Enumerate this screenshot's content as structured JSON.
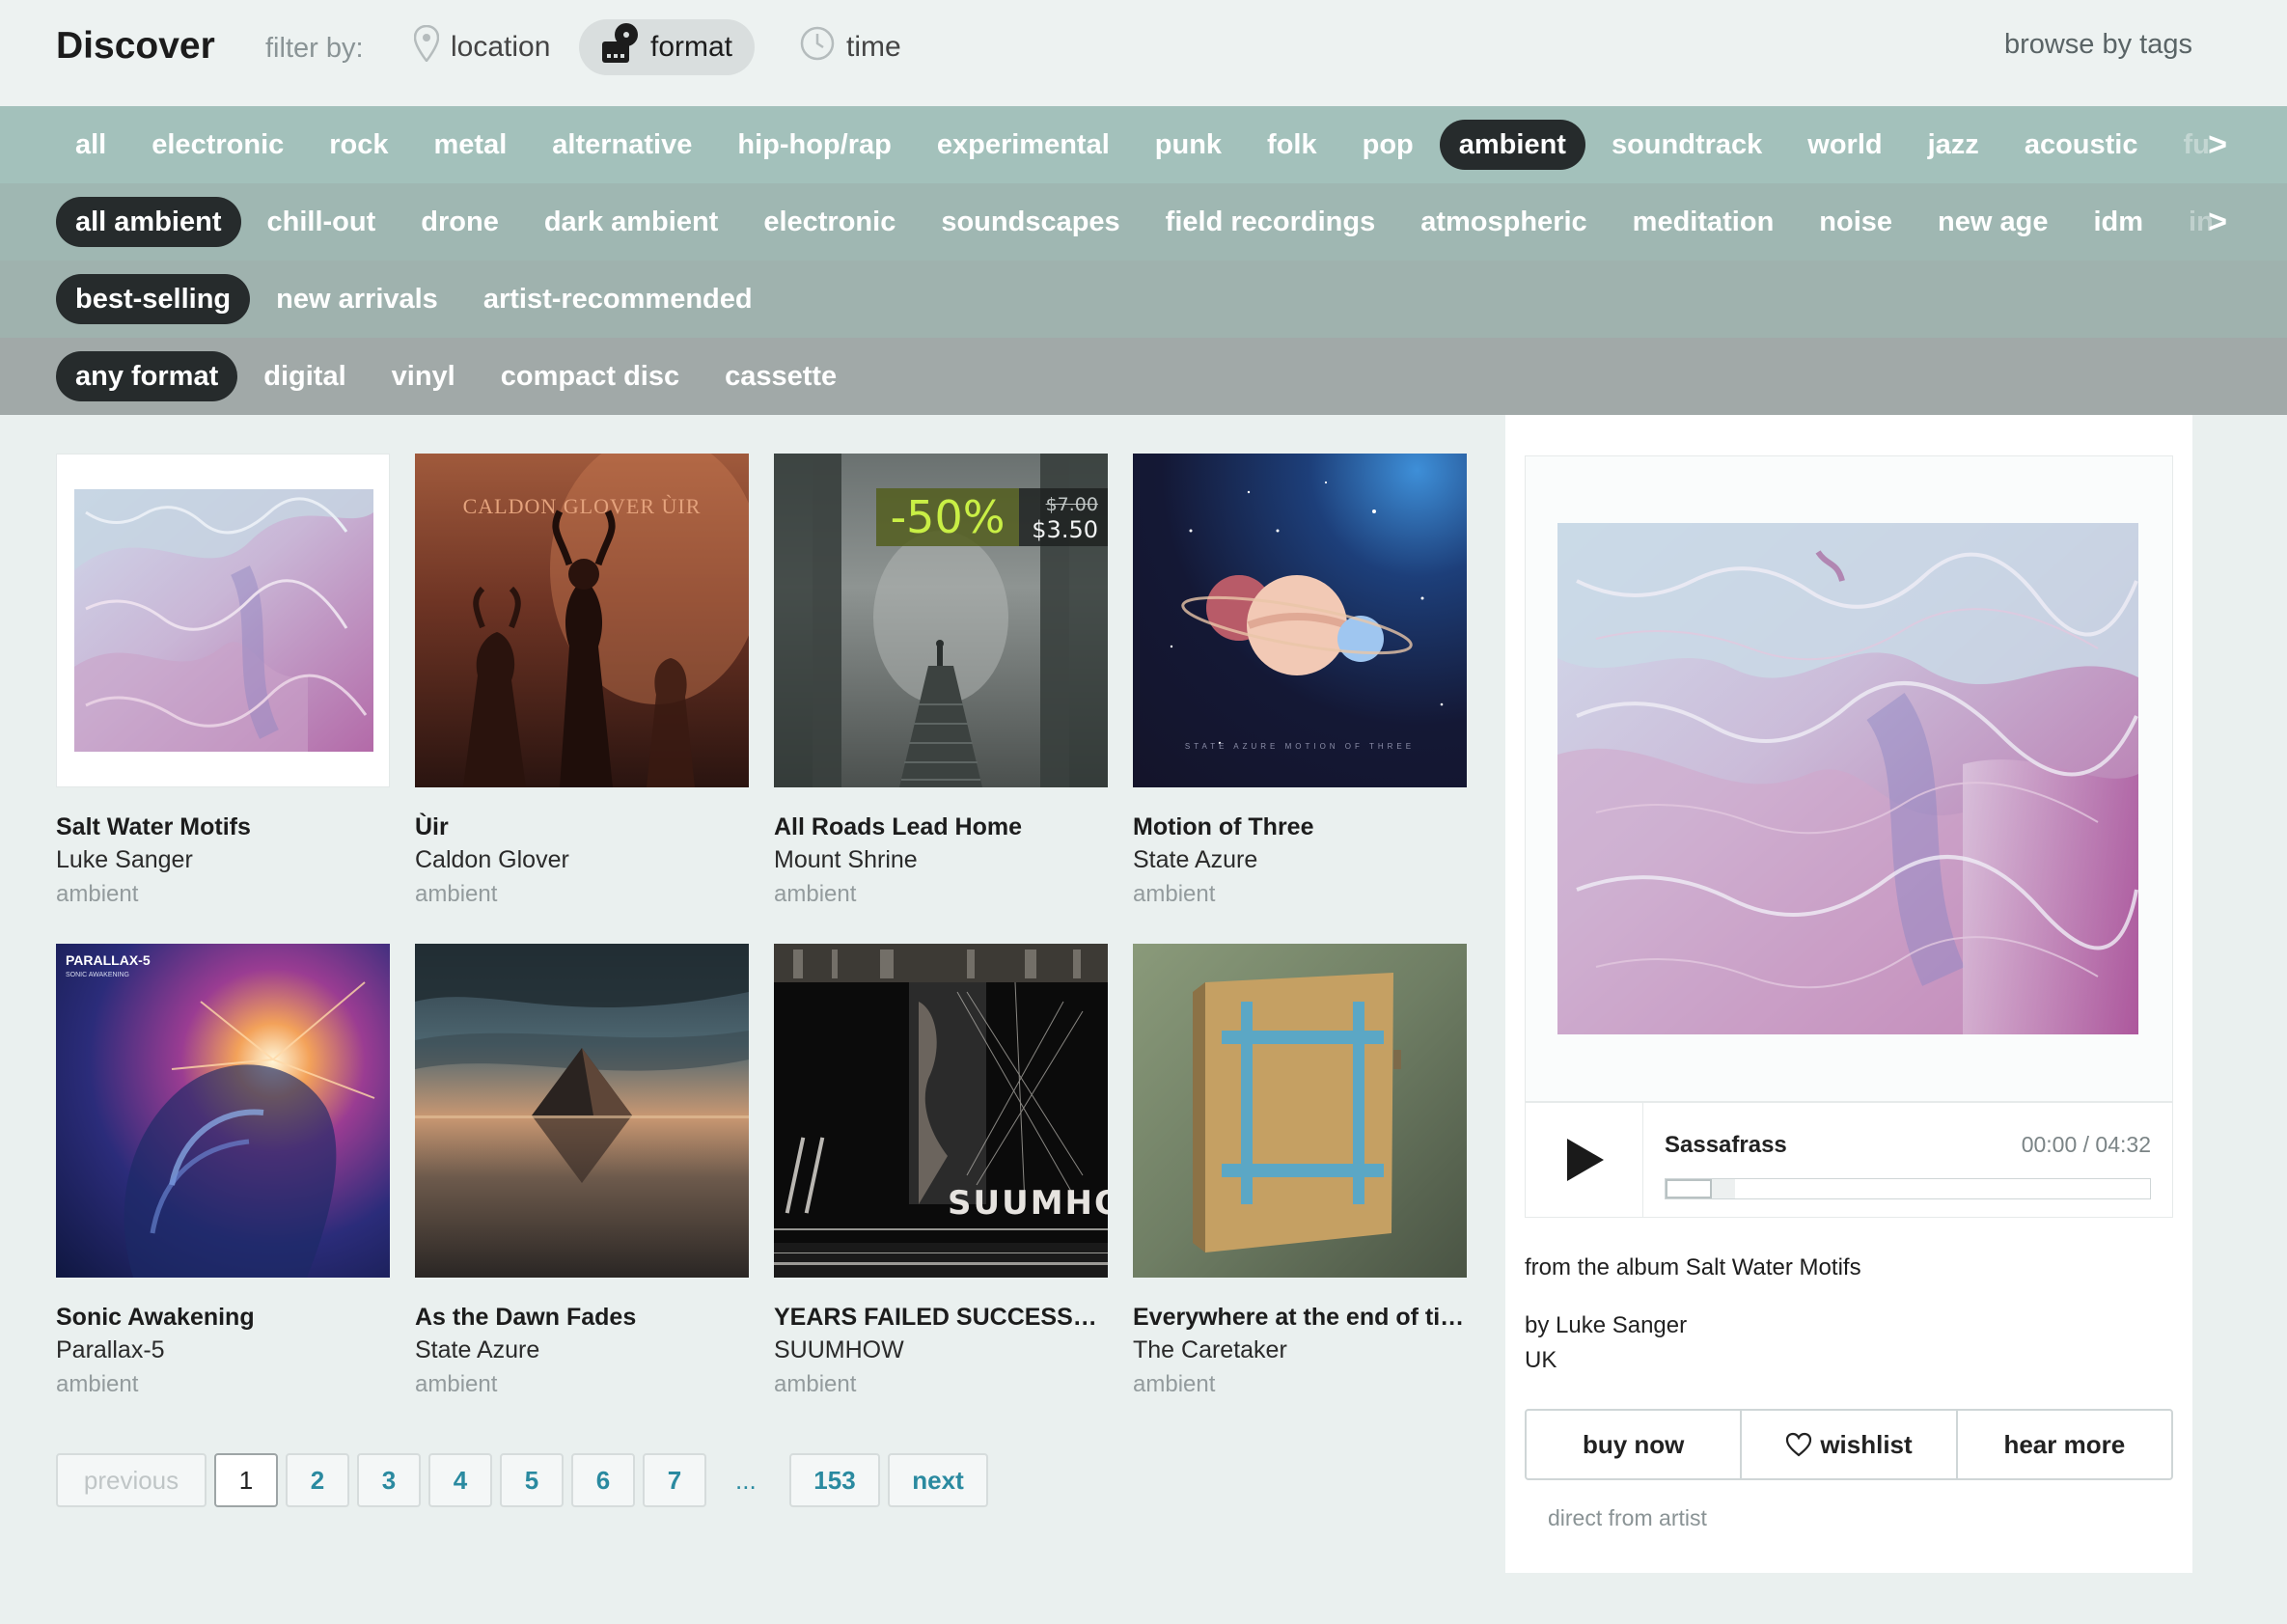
{
  "header": {
    "title": "Discover",
    "filter_label": "filter by:",
    "filters": [
      {
        "label": "location",
        "icon": "map-pin-icon"
      },
      {
        "label": "format",
        "icon": "vinyl-player-icon",
        "active": true
      },
      {
        "label": "time",
        "icon": "clock-icon"
      }
    ],
    "browse_tags": "browse by tags"
  },
  "genres": [
    "all",
    "electronic",
    "rock",
    "metal",
    "alternative",
    "hip-hop/rap",
    "experimental",
    "punk",
    "folk",
    "pop",
    "ambient",
    "soundtrack",
    "world",
    "jazz",
    "acoustic",
    "fu"
  ],
  "genre_active": "ambient",
  "subgenres": [
    "all ambient",
    "chill-out",
    "drone",
    "dark ambient",
    "electronic",
    "soundscapes",
    "field recordings",
    "atmospheric",
    "meditation",
    "noise",
    "new age",
    "idm",
    "in"
  ],
  "subgenre_active": "all ambient",
  "sorts": [
    "best-selling",
    "new arrivals",
    "artist-recommended"
  ],
  "sort_active": "best-selling",
  "formats": [
    "any format",
    "digital",
    "vinyl",
    "compact disc",
    "cassette"
  ],
  "format_active": "any format",
  "row_arrow": ">",
  "albums": [
    {
      "title": "Salt Water Motifs",
      "artist": "Luke Sanger",
      "genre": "ambient"
    },
    {
      "title": "Ùir",
      "artist": "Caldon Glover",
      "genre": "ambient",
      "cover_text": "CALDON GLOVER ÙIR"
    },
    {
      "title": "All Roads Lead Home",
      "artist": "Mount Shrine",
      "genre": "ambient",
      "discount": "-50%",
      "old_price": "$7.00",
      "new_price": "$3.50"
    },
    {
      "title": "Motion of Three",
      "artist": "State Azure",
      "genre": "ambient",
      "cover_text": "STATE AZURE     MOTION OF THREE"
    },
    {
      "title": "Sonic Awakening",
      "artist": "Parallax-5",
      "genre": "ambient",
      "cover_text": "PARALLAX-5",
      "cover_sub": "SONIC AWAKENING"
    },
    {
      "title": "As the Dawn Fades",
      "artist": "State Azure",
      "genre": "ambient"
    },
    {
      "title": "YEARS FAILED SUCCESSF…",
      "artist": "SUUMHOW",
      "genre": "ambient",
      "cover_text": "SUUMHOW"
    },
    {
      "title": "Everywhere at the end of time",
      "artist": "The Caretaker",
      "genre": "ambient"
    }
  ],
  "pagination": {
    "previous": "previous",
    "pages": [
      "1",
      "2",
      "3",
      "4",
      "5",
      "6",
      "7"
    ],
    "ellipsis": "...",
    "last": "153",
    "next": "next",
    "current": "1"
  },
  "player": {
    "track": "Sassafrass",
    "time": "00:00 / 04:32",
    "progress": 0.0,
    "from_prefix": "from the album",
    "album": "Salt Water Motifs",
    "by_line": "by Luke Sanger",
    "location": "UK",
    "buy_label": "buy now",
    "wishlist_label": "wishlist",
    "hear_more_label": "hear more",
    "direct": "direct from artist"
  },
  "colors": {
    "row1": "#a3c1bb",
    "row2": "#9fb7b2",
    "row3": "#9fb2ae",
    "row4": "#a1a9a8",
    "active_pill": "#262b2c",
    "link": "#2a8aa0"
  }
}
